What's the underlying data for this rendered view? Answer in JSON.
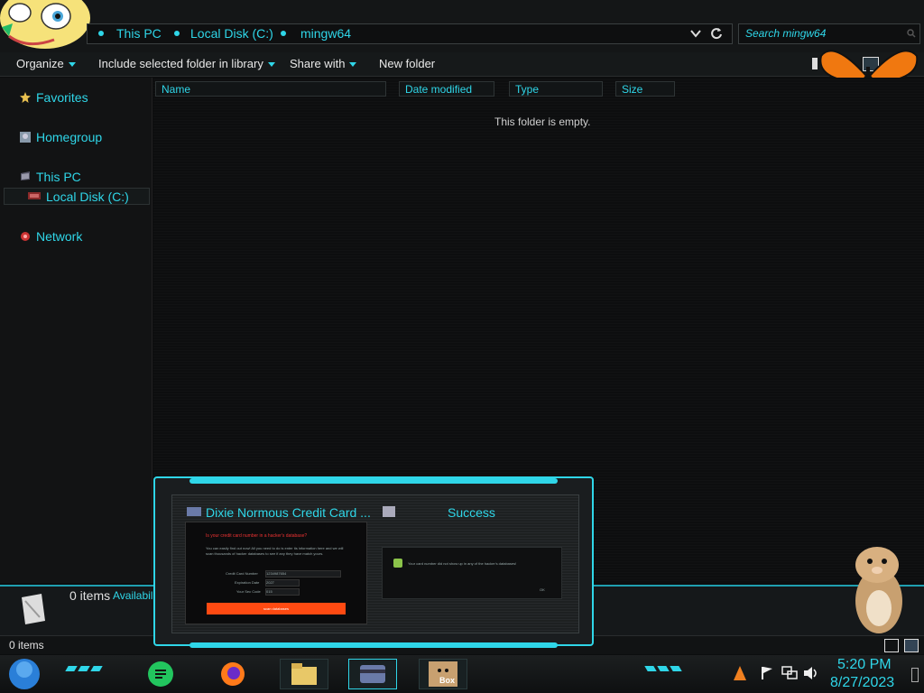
{
  "explorer": {
    "breadcrumbs": [
      "This PC",
      "Local Disk (C:)",
      "mingw64"
    ],
    "search_placeholder": "Search mingw64",
    "toolbar": {
      "organize": "Organize",
      "include": "Include selected folder in library",
      "share": "Share with",
      "new_folder": "New folder"
    },
    "nav": {
      "favorites": "Favorites",
      "homegroup": "Homegroup",
      "this_pc": "This PC",
      "local_disk": "Local Disk (C:)",
      "network": "Network"
    },
    "columns": [
      "Name",
      "Date modified",
      "Type",
      "Size"
    ],
    "empty_message": "This folder is empty.",
    "details_count": "0 items",
    "details_avail": "Availabil",
    "status_count": "0 items"
  },
  "dialog": {
    "app_title": "Dixie Normous Credit Card ...",
    "success_title": "Success",
    "app_heading": "Is your credit card number in a hacker's database?",
    "app_body": "You can easily find out now! All you need to do is enter its information here and we will scan thousands of hacker databases to see if any they have match yours.",
    "card_label": "Credit Card Number",
    "card_value": "1234987654",
    "exp_label": "Expiration Date",
    "exp_value": "2027",
    "sec_label": "Your Sec Code",
    "sec_value": "015",
    "check_button": "scan databases",
    "result_message": "Your card number did not show up in any of the hacker's databases!",
    "ok_button": "OK"
  },
  "taskbar": {
    "time": "5:20 PM",
    "date": "8/27/2023",
    "box_label": "Box"
  },
  "colors": {
    "accent": "#2fd6e8",
    "button_orange": "#ff4a12",
    "butterfly": "#f07810"
  }
}
